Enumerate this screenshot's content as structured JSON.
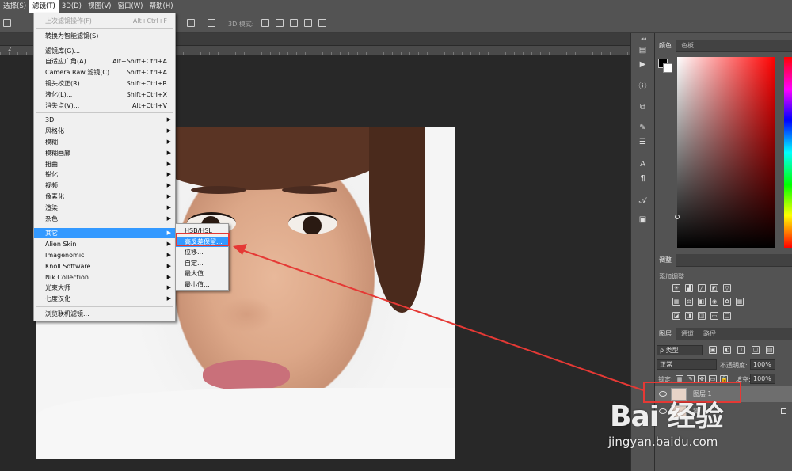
{
  "menubar": {
    "items": [
      "选择(S)",
      "滤镜(T)",
      "3D(D)",
      "视图(V)",
      "窗口(W)",
      "帮助(H)"
    ]
  },
  "optbar": {
    "mode_label": "3D 模式:"
  },
  "ruler": {
    "left_numbers": [
      "2"
    ]
  },
  "filter_menu": {
    "items": [
      {
        "label": "上次滤镜操作(F)",
        "shortcut": "Alt+Ctrl+F",
        "disabled": true
      },
      {
        "label": "转换为智能滤镜(S)",
        "shortcut": ""
      },
      {
        "label": "滤镜库(G)...",
        "shortcut": ""
      },
      {
        "label": "自适应广角(A)...",
        "shortcut": "Alt+Shift+Ctrl+A"
      },
      {
        "label": "Camera Raw 滤镜(C)...",
        "shortcut": "Shift+Ctrl+A"
      },
      {
        "label": "镜头校正(R)...",
        "shortcut": "Shift+Ctrl+R"
      },
      {
        "label": "液化(L)...",
        "shortcut": "Shift+Ctrl+X"
      },
      {
        "label": "消失点(V)...",
        "shortcut": "Alt+Ctrl+V"
      },
      {
        "label": "3D",
        "submenu": true
      },
      {
        "label": "风格化",
        "submenu": true
      },
      {
        "label": "模糊",
        "submenu": true
      },
      {
        "label": "模糊画廊",
        "submenu": true
      },
      {
        "label": "扭曲",
        "submenu": true
      },
      {
        "label": "锐化",
        "submenu": true
      },
      {
        "label": "视频",
        "submenu": true
      },
      {
        "label": "像素化",
        "submenu": true
      },
      {
        "label": "渲染",
        "submenu": true
      },
      {
        "label": "杂色",
        "submenu": true
      },
      {
        "label": "其它",
        "submenu": true,
        "highlighted": true
      },
      {
        "label": "Alien Skin",
        "submenu": true
      },
      {
        "label": "Imagenomic",
        "submenu": true
      },
      {
        "label": "Knoll Software",
        "submenu": true
      },
      {
        "label": "Nik Collection",
        "submenu": true
      },
      {
        "label": "光束大师",
        "submenu": true
      },
      {
        "label": "七度汉化",
        "submenu": true
      },
      {
        "label": "浏览联机滤镜...",
        "shortcut": ""
      }
    ]
  },
  "other_submenu": {
    "items": [
      "HSB/HSL",
      "高反差保留...",
      "位移...",
      "自定...",
      "最大值...",
      "最小值..."
    ],
    "highlighted_index": 1
  },
  "color_panel": {
    "tabs": [
      "颜色",
      "色板"
    ]
  },
  "adjust_panel": {
    "tab": "调整",
    "add_label": "添加调整"
  },
  "layers_panel": {
    "tabs": [
      "图层",
      "通道",
      "路径"
    ],
    "filter_kind": "ρ 类型",
    "blend_mode": "正常",
    "opacity_label": "不透明度:",
    "opacity_value": "100%",
    "lock_label": "锁定:",
    "fill_label": "填充:",
    "fill_value": "100%",
    "layers": [
      {
        "name": "图层 1",
        "selected": true
      },
      {
        "name": "背",
        "selected": false
      }
    ]
  },
  "watermark": {
    "logo": "Bai 经验",
    "url": "jingyan.baidu.com"
  }
}
